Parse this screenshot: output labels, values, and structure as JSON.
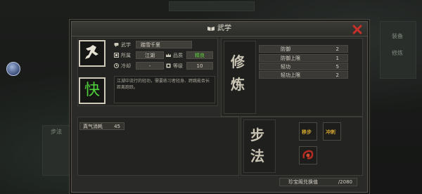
{
  "dialog": {
    "title": "武学",
    "title_icon": "book-icon",
    "close_icon": "close-x-icon",
    "accent": "#c6302a"
  },
  "skill": {
    "icon": "running-figure-icon",
    "glyph": "快",
    "glyph_color": "#4fd23a",
    "wuxue_label": "武学",
    "name": "踏雪千里",
    "sect_label": "所属",
    "sect": "江湖",
    "quality_label": "品质",
    "quality": "精良",
    "cooldown_label": "冷却",
    "cooldown": "-",
    "level_label": "等级",
    "level": "10",
    "description": "江湖中流行的轻功，需要练习者轻身、跨跳能否长距离跑跃。"
  },
  "xiulian": {
    "heading_1": "修",
    "heading_2": "炼",
    "stats": [
      {
        "name": "防御",
        "value": "2"
      },
      {
        "name": "防御上限",
        "value": "1"
      },
      {
        "name": "轻功",
        "value": "5"
      },
      {
        "name": "轻功上限",
        "value": "2"
      }
    ]
  },
  "qi": {
    "label": "真气消耗",
    "value": "45"
  },
  "bufa": {
    "heading_1": "步",
    "heading_2": "法",
    "slots": [
      {
        "label": "移步",
        "icon": "move-step-icon"
      },
      {
        "label": "冲刺",
        "icon": "dash-icon"
      },
      {
        "label": "",
        "icon": "red-swirl-icon"
      }
    ]
  },
  "footer": {
    "label": "珍宝阁兑换值",
    "value": "/2080"
  },
  "background": {
    "right_snippet_1": "装备",
    "right_snippet_2": "修炼",
    "left_snippet": "步法"
  }
}
